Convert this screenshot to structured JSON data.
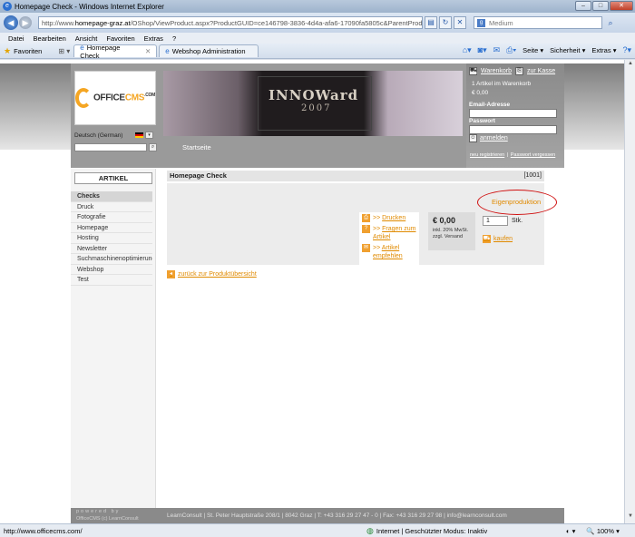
{
  "window": {
    "title": "Homepage Check - Windows Internet Explorer"
  },
  "address": {
    "url_prefix": "http://www.",
    "url_domain": "homepage-graz.at",
    "url_rest": "/OShop/ViewProduct.aspx?ProductGUID=ce146798-3836-4d4a-afa6-17090fa5805c&ParentProductCategoryG",
    "search_value": "Medium"
  },
  "menu": [
    "Datei",
    "Bearbeiten",
    "Ansicht",
    "Favoriten",
    "Extras",
    "?"
  ],
  "tabs": {
    "favorites_label": "Favoriten",
    "active_tab": "Homepage Check",
    "inactive_tab": "Webshop Administration"
  },
  "commandbar": {
    "page": "Seite",
    "security": "Sicherheit",
    "tools": "Extras"
  },
  "site": {
    "logo_prefix": "OFFICE",
    "logo_cms": "CMS",
    "logo_suffix": ".COM",
    "language": "Deutsch (German)",
    "banner_brand": "INNOWard",
    "banner_year": "2007",
    "home_link": "Startseite",
    "cart_link": "Warenkorb",
    "checkout_link": "zur Kasse",
    "cart_count": "1 Artikel im Warenkorb",
    "cart_total": "€ 0,00",
    "email_label": "Email-Adresse",
    "password_label": "Passwort",
    "login_link": "anmelden",
    "register_link": "neu registrieren",
    "forgot_link": "Passwort vergessen",
    "sep": "|"
  },
  "nav": {
    "title": "ARTIKEL",
    "items": [
      "Checks",
      "Druck",
      "Fotografie",
      "Homepage",
      "Hosting",
      "Newsletter",
      "Suchmaschinenoptimierung",
      "Webshop",
      "Test"
    ]
  },
  "product": {
    "name": "Homepage Check",
    "number": "[1001]",
    "badge": "Eigenproduktion",
    "action_print": "Drucken",
    "action_questions": "Fragen zum Artikel",
    "action_recommend": "Artikel empfehlen",
    "action_prefix": ">>",
    "price": "€ 0,00",
    "price_note": "inkl. 20% MwSt. zzgl. Versand",
    "qty_value": "1",
    "qty_unit": "Stk.",
    "buy_label": "kaufen",
    "back_link": "zurück zur Produktübersicht"
  },
  "footer": {
    "powered_by": "powered by",
    "powered_brand": "OfficeCMS (c) LearnConsult",
    "info": "LearnConsult | St. Peter Hauptstraße 208/1 | 8042 Graz | T: +43 316 29 27 47 - 0 | Fax: +43 316 29 27 98 | info@learnconsult.com"
  },
  "status": {
    "url": "http://www.officecms.com/",
    "zone": "Internet | Geschützter Modus: Inaktiv",
    "zoom": "100%"
  }
}
